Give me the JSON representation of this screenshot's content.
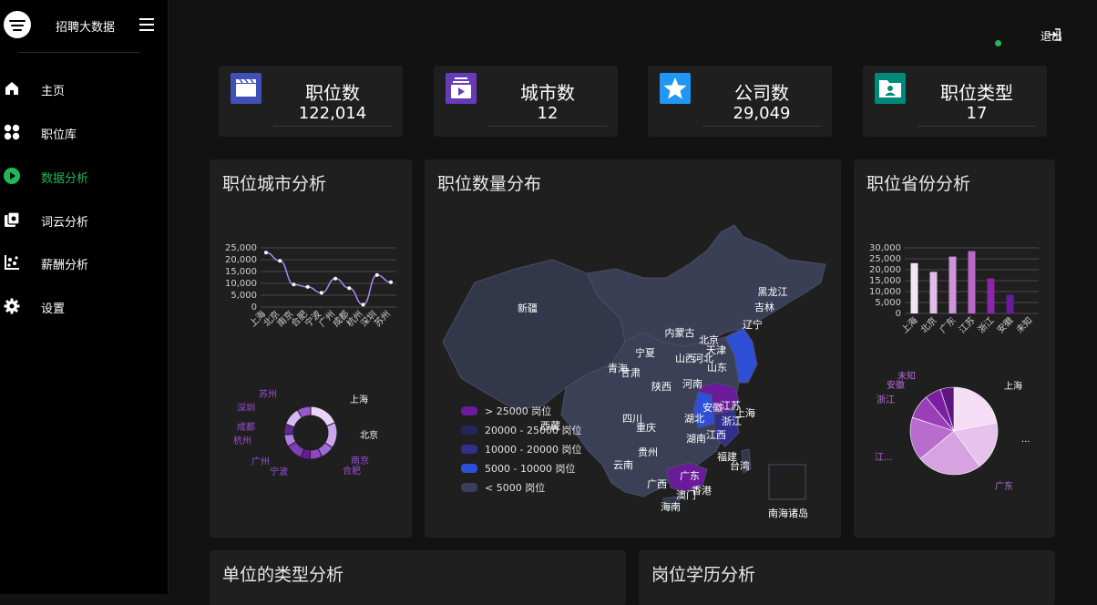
{
  "app": {
    "title": "招聘大数据"
  },
  "sidebar": {
    "items": [
      {
        "label": "主页"
      },
      {
        "label": "职位库"
      },
      {
        "label": "数据分析"
      },
      {
        "label": "词云分析"
      },
      {
        "label": "薪酬分析"
      },
      {
        "label": "设置"
      }
    ]
  },
  "header": {
    "logout_label": "退出"
  },
  "stats": [
    {
      "label": "职位数",
      "value": "122,014",
      "color": "#3f51b5"
    },
    {
      "label": "城市数",
      "value": "12",
      "color": "#673ab7"
    },
    {
      "label": "公司数",
      "value": "29,049",
      "color": "#2196f3"
    },
    {
      "label": "职位类型",
      "value": "17",
      "color": "#00897b"
    }
  ],
  "panels": {
    "city": {
      "title": "职位城市分析"
    },
    "map": {
      "title": "职位数量分布"
    },
    "province": {
      "title": "职位省份分析"
    },
    "unit": {
      "title": "单位的类型分析"
    },
    "edu": {
      "title": "岗位学历分析"
    }
  },
  "map": {
    "legend": [
      {
        "label": "> 25000 岗位",
        "color": "#6a1b9a"
      },
      {
        "label": "20000 - 25000 岗位",
        "color": "#25245a"
      },
      {
        "label": "10000 - 20000 岗位",
        "color": "#312f8c"
      },
      {
        "label": "5000 - 10000 岗位",
        "color": "#2f4fd6"
      },
      {
        "label": "< 5000 岗位",
        "color": "#3a3d5c"
      }
    ],
    "labels": [
      "新疆",
      "黑龙江",
      "吉林",
      "辽宁",
      "内蒙古",
      "北京",
      "天津",
      "河北",
      "山西",
      "山东",
      "宁夏",
      "青海",
      "甘肃",
      "陕西",
      "河南",
      "西藏",
      "四川",
      "重庆",
      "湖北",
      "安徽",
      "江苏",
      "上海",
      "浙江",
      "湖南",
      "江西",
      "福建",
      "台湾",
      "贵州",
      "云南",
      "广西",
      "广东",
      "香港",
      "澳门",
      "海南",
      "南海诸岛"
    ]
  },
  "chart_data": [
    {
      "type": "line",
      "categories": [
        "上海",
        "北京",
        "南京",
        "合肥",
        "宁波",
        "广州",
        "成都",
        "杭州",
        "深圳",
        "苏州"
      ],
      "values": [
        23000,
        19500,
        9500,
        8500,
        6000,
        12000,
        8000,
        1000,
        13500,
        10500
      ],
      "ylim": [
        0,
        25000
      ],
      "yticks": [
        "25,000",
        "20,000",
        "15,000",
        "10,000",
        "5,000",
        "0"
      ],
      "grid": true
    },
    {
      "type": "pie",
      "labels": [
        "上海",
        "北京",
        "南京",
        "合肥",
        "宁波",
        "广州",
        "杭州",
        "成都",
        "深圳",
        "苏州"
      ],
      "values": [
        20,
        17,
        9,
        8,
        6,
        11,
        8,
        7,
        12,
        9
      ]
    },
    {
      "type": "bar",
      "categories": [
        "上海",
        "北京",
        "广东",
        "江苏",
        "浙江",
        "安徽",
        "未知"
      ],
      "values": [
        23000,
        19000,
        26000,
        28500,
        16000,
        8500,
        0
      ],
      "ylim": [
        0,
        30000
      ],
      "yticks": [
        "30,000",
        "25,000",
        "20,000",
        "15,000",
        "10,000",
        "5,000",
        "0"
      ],
      "grid": true
    },
    {
      "type": "pie",
      "labels": [
        "上海",
        "...",
        "广东",
        "江...",
        "浙江",
        "安徽",
        "未知"
      ],
      "values": [
        22,
        18,
        24,
        16,
        9,
        6,
        5
      ]
    }
  ]
}
